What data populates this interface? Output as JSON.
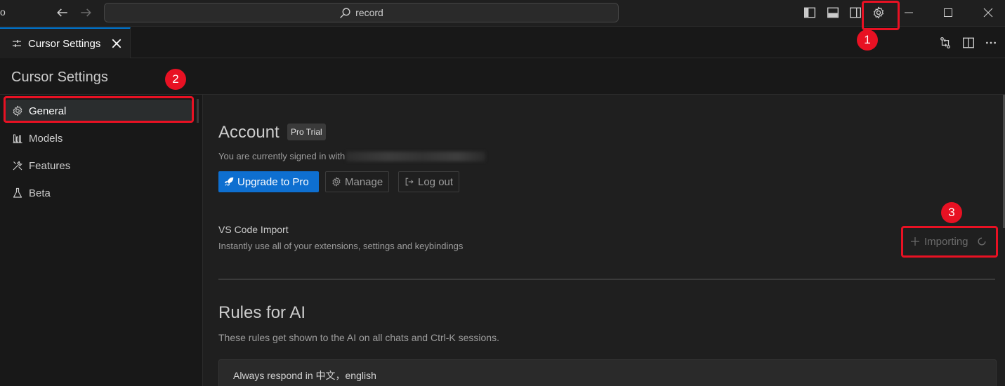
{
  "titlebar": {
    "edge_glyph": "o",
    "search_text": "record"
  },
  "tab": {
    "label": "Cursor Settings"
  },
  "page": {
    "title": "Cursor Settings"
  },
  "sidebar": {
    "items": [
      {
        "label": "General",
        "icon": "gear-icon",
        "active": true
      },
      {
        "label": "Models",
        "icon": "bar-chart-icon",
        "active": false
      },
      {
        "label": "Features",
        "icon": "tools-icon",
        "active": false
      },
      {
        "label": "Beta",
        "icon": "flask-icon",
        "active": false
      }
    ]
  },
  "account": {
    "title": "Account",
    "badge": "Pro Trial",
    "signed_in_text": "You are currently signed in with",
    "upgrade_label": "Upgrade to Pro",
    "manage_label": "Manage",
    "logout_label": "Log out"
  },
  "vscode_import": {
    "title": "VS Code Import",
    "description": "Instantly use all of your extensions, settings and keybindings",
    "button_label": "Importing"
  },
  "rules": {
    "title": "Rules for AI",
    "description": "These rules get shown to the AI on all chats and Ctrl-K sessions.",
    "value": "Always respond in 中文，english"
  },
  "annotations": {
    "labels": [
      "1",
      "2",
      "3"
    ],
    "color": "#e81123"
  },
  "colors": {
    "accent": "#0078d4",
    "primary_button": "#0e6fd0",
    "background": "#181818",
    "panel": "#1f1f1f"
  }
}
